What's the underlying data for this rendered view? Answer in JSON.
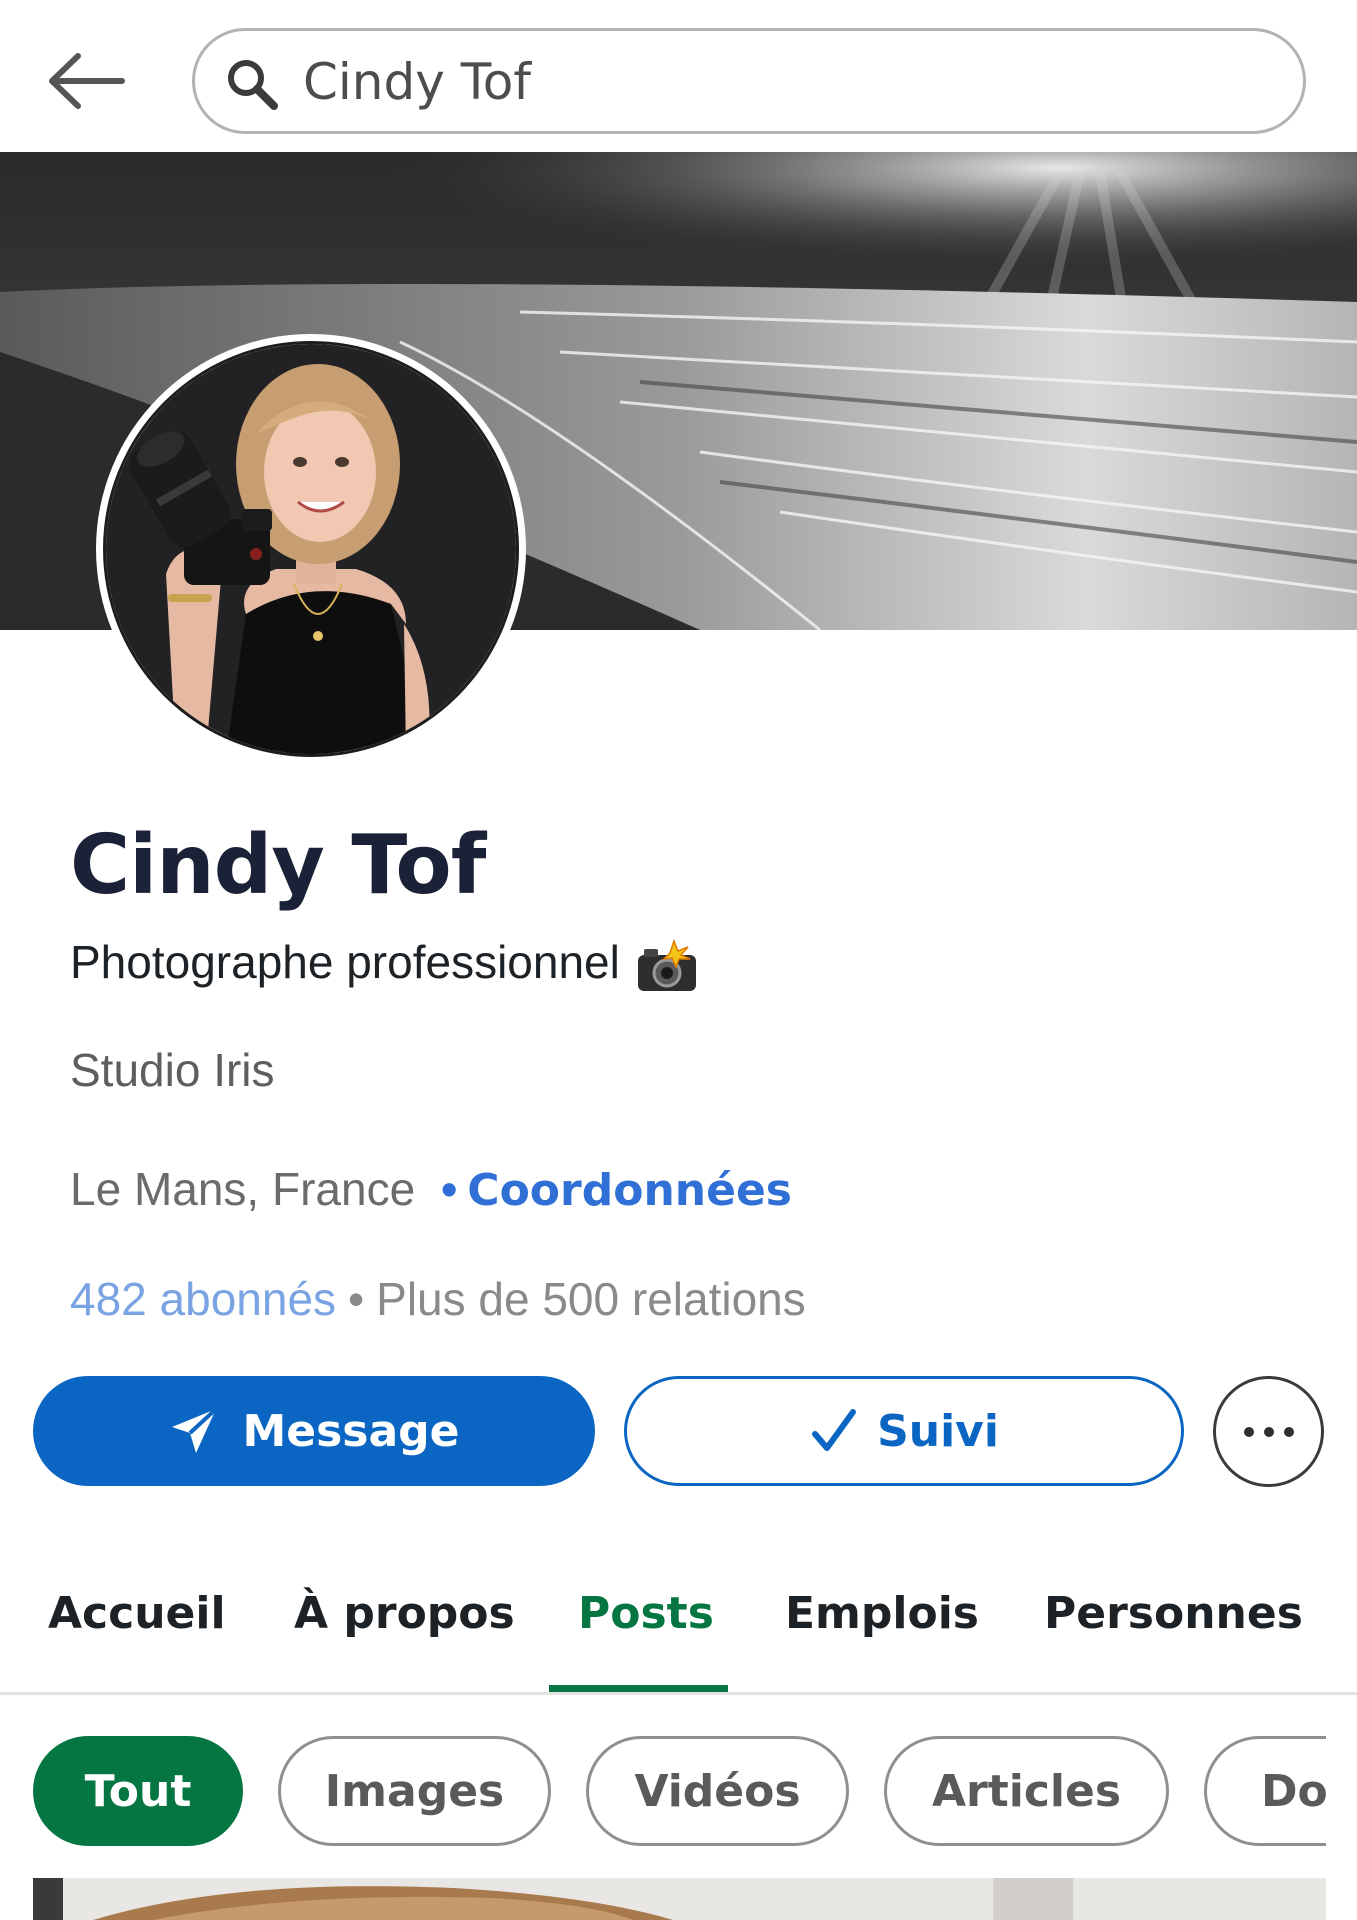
{
  "search": {
    "query": "Cindy Tof"
  },
  "profile": {
    "name": "Cindy Tof",
    "headline": "Photographe professionnel",
    "company": "Studio Iris",
    "location": "Le Mans, France",
    "contact_link": "Coordonnées",
    "followers": "482 abonnés",
    "connections": "Plus de 500 relations",
    "separator": "•"
  },
  "actions": {
    "message_label": "Message",
    "follow_label": "Suivi"
  },
  "tabs": [
    {
      "label": "Accueil"
    },
    {
      "label": "À propos"
    },
    {
      "label": "Posts",
      "active": true
    },
    {
      "label": "Emplois"
    },
    {
      "label": "Personnes"
    }
  ],
  "filters": [
    {
      "label": "Tout",
      "active": true
    },
    {
      "label": "Images"
    },
    {
      "label": "Vidéos"
    },
    {
      "label": "Articles"
    },
    {
      "label": "Documents"
    }
  ],
  "colors": {
    "primary_blue": "#0a66c2",
    "active_green": "#057642",
    "name_navy": "#1b2237"
  },
  "icons": {
    "back": "arrow-left-icon",
    "search": "search-icon",
    "message": "paper-plane-icon",
    "follow": "checkmark-icon",
    "more": "more-horizontal-icon",
    "headline_emoji": "camera-flash-icon"
  }
}
